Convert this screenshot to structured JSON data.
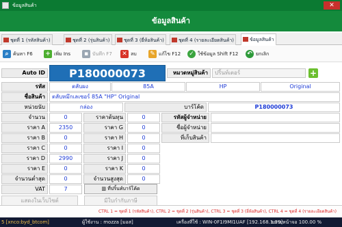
{
  "window": {
    "title": "ข้อมูลสินค้า",
    "close": "✕"
  },
  "header": {
    "title": "ข้อมูลสินค้า"
  },
  "tabs": [
    {
      "label": "ชุดที่ 1 (รหัสสินค้า)"
    },
    {
      "label": "ชุดที่ 2 (รุ่นสินค้า)"
    },
    {
      "label": "ชุดที่ 3 (ยี่ห้อสินค้า)"
    },
    {
      "label": "ชุดที่ 4 (รายละเอียดสินค้า)"
    },
    {
      "label": "ข้อมูลสินค้า"
    }
  ],
  "toolbar": {
    "search": "ค้นหา F6",
    "add": "เพิ่ม Ins",
    "save": "บันทึก F7",
    "delete": "ลบ",
    "edit": "แก้ไข F12",
    "use_data": "ใช้ข้อมูล Shift F12",
    "cancel": "ยกเลิก"
  },
  "form": {
    "autoid_label": "Auto ID",
    "autoid_value": "P180000073",
    "category_label": "หมวดหมู่สินค้า",
    "category_value": "ปริ้นท์เตอร์",
    "code_label": "รหัส",
    "code_parts": [
      "ตลับผง",
      "85A",
      "HP",
      "Original"
    ],
    "name_label": "ชื่อสินค้า",
    "name_value": "ตลับหมึกเลเซอร์ 85A \"HP\" Original",
    "unit_label": "หน่วยนับ",
    "unit_value": "กล่อง",
    "barcode_label": "บาร์โค้ด",
    "barcode_value": "P180000073",
    "qty_label": "จำนวน",
    "qty_value": "0",
    "cost_label": "ราคาต้นทุน",
    "cost_value": "0",
    "supplier_code_label": "รหัสผู้จำหน่าย",
    "supplier_name_label": "ชื่อผู้จำหน่าย",
    "location_label": "ที่เก็บสินค้า",
    "prices_left": [
      {
        "label": "ราคา A",
        "value": "2350"
      },
      {
        "label": "ราคา B",
        "value": "0"
      },
      {
        "label": "ราคา C",
        "value": "0"
      },
      {
        "label": "ราคา D",
        "value": "2990"
      },
      {
        "label": "ราคา E",
        "value": "0"
      },
      {
        "label": "ราคา F",
        "value": "0"
      }
    ],
    "prices_right": [
      {
        "label": "ราคา G",
        "value": "0"
      },
      {
        "label": "ราคา H",
        "value": "0"
      },
      {
        "label": "ราคา I",
        "value": "0"
      },
      {
        "label": "ราคา J",
        "value": "0"
      },
      {
        "label": "ราคา K",
        "value": "0"
      },
      {
        "label": "ราคา L",
        "value": "0"
      }
    ],
    "min_label": "จำนวนต่ำสุด",
    "min_value": "0",
    "max_label": "จำนวนสูงสุด",
    "max_value": "0",
    "vat_label": "VAT",
    "vat_value": "7",
    "barcode_print_button": "ที่ปริ้นท์บาร์โค้ด",
    "show_web_button": "แสดงในเว็บไซต์",
    "tax_button": "มีใบกำกับภาษี"
  },
  "shortcut_hint": "CTRL 1 = ชุดที่ 1 (รหัสสินค้า), CTRL 2 = ชุดที่ 2 (รุ่นสินค้า), CTRL 3 = ชุดที่ 3 (ยี่ห้อสินค้า), CTRL 4 = ชุดที่ 4 (รายละเอียดสินค้า)",
  "statusbar": {
    "left": "5 [xnco:byd_btcom]",
    "user": "ผู้ใช้งาน : mozza [มอส]",
    "computer": "เครื่องที่ใช้ : WIN-0F1I9MI1UAF [192.168.1.39]",
    "zoom": "ขยายหน้าจอ 100.00 %"
  },
  "colors": {
    "titlebar": "#0b7a32",
    "header": "#148a3c",
    "autoid_bg": "#1f6fb6",
    "value_text": "#1c3ad6",
    "statusbar": "#121a33"
  }
}
